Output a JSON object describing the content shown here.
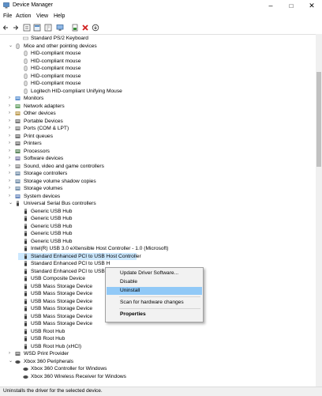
{
  "window": {
    "title": "Device Manager",
    "minimize": "–",
    "maximize": "□",
    "close": "✕"
  },
  "menu": [
    "File",
    "Action",
    "View",
    "Help"
  ],
  "toolbar": [
    "back-icon",
    "forward-icon",
    "properties-icon",
    "refresh-icon",
    "help-icon",
    "monitor-icon",
    "update-driver-icon",
    "uninstall-icon",
    "scan-icon"
  ],
  "tree": [
    {
      "label": "Standard PS/2 Keyboard",
      "level": 2,
      "icon": "keyboard-icon"
    },
    {
      "label": "Mice and other pointing devices",
      "level": 1,
      "icon": "mouse-category-icon",
      "expanded": true
    },
    {
      "label": "HID-compliant mouse",
      "level": 2,
      "icon": "mouse-icon"
    },
    {
      "label": "HID-compliant mouse",
      "level": 2,
      "icon": "mouse-icon"
    },
    {
      "label": "HID-compliant mouse",
      "level": 2,
      "icon": "mouse-icon"
    },
    {
      "label": "HID-compliant mouse",
      "level": 2,
      "icon": "mouse-icon"
    },
    {
      "label": "HID-compliant mouse",
      "level": 2,
      "icon": "mouse-icon"
    },
    {
      "label": "Logitech HID-compliant Unifying Mouse",
      "level": 2,
      "icon": "mouse-icon"
    },
    {
      "label": "Monitors",
      "level": 1,
      "icon": "monitor-icon"
    },
    {
      "label": "Network adapters",
      "level": 1,
      "icon": "network-adapter-icon"
    },
    {
      "label": "Other devices",
      "level": 1,
      "icon": "other-devices-icon"
    },
    {
      "label": "Portable Devices",
      "level": 1,
      "icon": "portable-device-icon"
    },
    {
      "label": "Ports (COM & LPT)",
      "level": 1,
      "icon": "port-icon"
    },
    {
      "label": "Print queues",
      "level": 1,
      "icon": "printer-icon"
    },
    {
      "label": "Printers",
      "level": 1,
      "icon": "printer-icon"
    },
    {
      "label": "Processors",
      "level": 1,
      "icon": "processor-icon"
    },
    {
      "label": "Software devices",
      "level": 1,
      "icon": "software-device-icon"
    },
    {
      "label": "Sound, video and game controllers",
      "level": 1,
      "icon": "sound-icon"
    },
    {
      "label": "Storage controllers",
      "level": 1,
      "icon": "storage-icon"
    },
    {
      "label": "Storage volume shadow copies",
      "level": 1,
      "icon": "storage-icon"
    },
    {
      "label": "Storage volumes",
      "level": 1,
      "icon": "storage-icon"
    },
    {
      "label": "System devices",
      "level": 1,
      "icon": "system-device-icon"
    },
    {
      "label": "Universal Serial Bus controllers",
      "level": 1,
      "icon": "usb-category-icon",
      "expanded": true
    },
    {
      "label": "Generic USB Hub",
      "level": 2,
      "icon": "usb-icon"
    },
    {
      "label": "Generic USB Hub",
      "level": 2,
      "icon": "usb-icon"
    },
    {
      "label": "Generic USB Hub",
      "level": 2,
      "icon": "usb-icon"
    },
    {
      "label": "Generic USB Hub",
      "level": 2,
      "icon": "usb-icon"
    },
    {
      "label": "Generic USB Hub",
      "level": 2,
      "icon": "usb-icon"
    },
    {
      "label": "Intel(R) USB 3.0 eXtensible Host Controller - 1.0 (Microsoft)",
      "level": 2,
      "icon": "usb-icon"
    },
    {
      "label": "Standard Enhanced PCI to USB Host Controller",
      "level": 2,
      "icon": "usb-icon",
      "selected": true
    },
    {
      "label": "Standard Enhanced PCI to USB H",
      "level": 2,
      "icon": "usb-icon"
    },
    {
      "label": "Standard Enhanced PCI to USB H",
      "level": 2,
      "icon": "usb-icon"
    },
    {
      "label": "USB Composite Device",
      "level": 2,
      "icon": "usb-icon"
    },
    {
      "label": "USB Mass Storage Device",
      "level": 2,
      "icon": "usb-icon"
    },
    {
      "label": "USB Mass Storage Device",
      "level": 2,
      "icon": "usb-icon"
    },
    {
      "label": "USB Mass Storage Device",
      "level": 2,
      "icon": "usb-icon"
    },
    {
      "label": "USB Mass Storage Device",
      "level": 2,
      "icon": "usb-icon"
    },
    {
      "label": "USB Mass Storage Device",
      "level": 2,
      "icon": "usb-icon"
    },
    {
      "label": "USB Mass Storage Device",
      "level": 2,
      "icon": "usb-icon"
    },
    {
      "label": "USB Root Hub",
      "level": 2,
      "icon": "usb-icon"
    },
    {
      "label": "USB Root Hub",
      "level": 2,
      "icon": "usb-icon"
    },
    {
      "label": "USB Root Hub (xHCI)",
      "level": 2,
      "icon": "usb-icon"
    },
    {
      "label": "WSD Print Provider",
      "level": 1,
      "icon": "printer-icon"
    },
    {
      "label": "Xbox 360 Peripherals",
      "level": 1,
      "icon": "gamepad-icon",
      "expanded": true
    },
    {
      "label": "Xbox 360 Controller for Windows",
      "level": 2,
      "icon": "gamepad-icon"
    },
    {
      "label": "Xbox 360 Wireless Receiver for Windows",
      "level": 2,
      "icon": "gamepad-icon"
    }
  ],
  "context_menu": {
    "items": [
      "Update Driver Software...",
      "Disable",
      "Uninstall",
      "Scan for hardware changes",
      "Properties"
    ],
    "highlighted": "Uninstall"
  },
  "status": "Uninstalls the driver for the selected device.",
  "colors": {
    "selection": "#cce8ff",
    "menu_highlight": "#91c9f7",
    "status_bg": "#f0f0f0"
  }
}
